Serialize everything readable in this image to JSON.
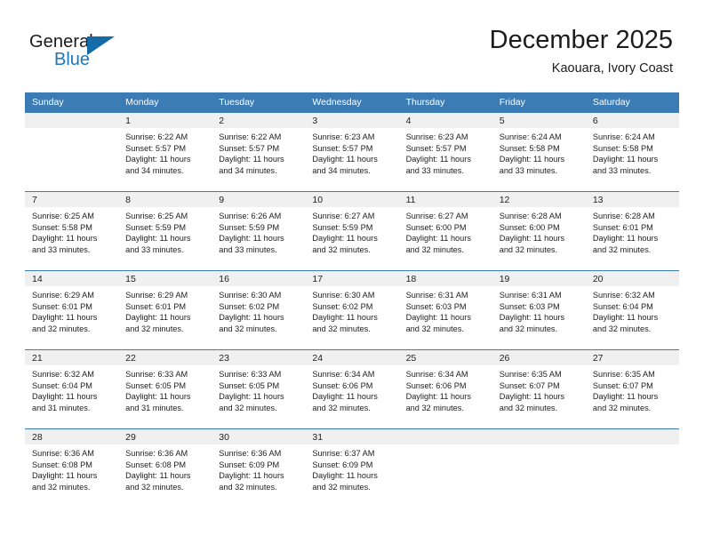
{
  "brand": {
    "name_part1": "General",
    "name_part2": "Blue",
    "flag_icon": "triangle-flag-icon",
    "accent_color": "#1878be"
  },
  "header": {
    "month_title": "December 2025",
    "location": "Kaouara, Ivory Coast"
  },
  "theme": {
    "header_row_bg": "#3b7cb5",
    "daynum_band_bg": "#f0f0f0",
    "cell_bg": "#ffffff",
    "text_color": "#1d1d1d"
  },
  "weekday_headers": [
    "Sunday",
    "Monday",
    "Tuesday",
    "Wednesday",
    "Thursday",
    "Friday",
    "Saturday"
  ],
  "weeks": [
    {
      "days": [
        {
          "number": "",
          "sunrise": "",
          "sunset": "",
          "daylight_line1": "",
          "daylight_line2": "",
          "empty": true
        },
        {
          "number": "1",
          "sunrise": "Sunrise: 6:22 AM",
          "sunset": "Sunset: 5:57 PM",
          "daylight_line1": "Daylight: 11 hours",
          "daylight_line2": "and 34 minutes.",
          "empty": false
        },
        {
          "number": "2",
          "sunrise": "Sunrise: 6:22 AM",
          "sunset": "Sunset: 5:57 PM",
          "daylight_line1": "Daylight: 11 hours",
          "daylight_line2": "and 34 minutes.",
          "empty": false
        },
        {
          "number": "3",
          "sunrise": "Sunrise: 6:23 AM",
          "sunset": "Sunset: 5:57 PM",
          "daylight_line1": "Daylight: 11 hours",
          "daylight_line2": "and 34 minutes.",
          "empty": false
        },
        {
          "number": "4",
          "sunrise": "Sunrise: 6:23 AM",
          "sunset": "Sunset: 5:57 PM",
          "daylight_line1": "Daylight: 11 hours",
          "daylight_line2": "and 33 minutes.",
          "empty": false
        },
        {
          "number": "5",
          "sunrise": "Sunrise: 6:24 AM",
          "sunset": "Sunset: 5:58 PM",
          "daylight_line1": "Daylight: 11 hours",
          "daylight_line2": "and 33 minutes.",
          "empty": false
        },
        {
          "number": "6",
          "sunrise": "Sunrise: 6:24 AM",
          "sunset": "Sunset: 5:58 PM",
          "daylight_line1": "Daylight: 11 hours",
          "daylight_line2": "and 33 minutes.",
          "empty": false
        }
      ]
    },
    {
      "days": [
        {
          "number": "7",
          "sunrise": "Sunrise: 6:25 AM",
          "sunset": "Sunset: 5:58 PM",
          "daylight_line1": "Daylight: 11 hours",
          "daylight_line2": "and 33 minutes.",
          "empty": false
        },
        {
          "number": "8",
          "sunrise": "Sunrise: 6:25 AM",
          "sunset": "Sunset: 5:59 PM",
          "daylight_line1": "Daylight: 11 hours",
          "daylight_line2": "and 33 minutes.",
          "empty": false
        },
        {
          "number": "9",
          "sunrise": "Sunrise: 6:26 AM",
          "sunset": "Sunset: 5:59 PM",
          "daylight_line1": "Daylight: 11 hours",
          "daylight_line2": "and 33 minutes.",
          "empty": false
        },
        {
          "number": "10",
          "sunrise": "Sunrise: 6:27 AM",
          "sunset": "Sunset: 5:59 PM",
          "daylight_line1": "Daylight: 11 hours",
          "daylight_line2": "and 32 minutes.",
          "empty": false
        },
        {
          "number": "11",
          "sunrise": "Sunrise: 6:27 AM",
          "sunset": "Sunset: 6:00 PM",
          "daylight_line1": "Daylight: 11 hours",
          "daylight_line2": "and 32 minutes.",
          "empty": false
        },
        {
          "number": "12",
          "sunrise": "Sunrise: 6:28 AM",
          "sunset": "Sunset: 6:00 PM",
          "daylight_line1": "Daylight: 11 hours",
          "daylight_line2": "and 32 minutes.",
          "empty": false
        },
        {
          "number": "13",
          "sunrise": "Sunrise: 6:28 AM",
          "sunset": "Sunset: 6:01 PM",
          "daylight_line1": "Daylight: 11 hours",
          "daylight_line2": "and 32 minutes.",
          "empty": false
        }
      ]
    },
    {
      "days": [
        {
          "number": "14",
          "sunrise": "Sunrise: 6:29 AM",
          "sunset": "Sunset: 6:01 PM",
          "daylight_line1": "Daylight: 11 hours",
          "daylight_line2": "and 32 minutes.",
          "empty": false
        },
        {
          "number": "15",
          "sunrise": "Sunrise: 6:29 AM",
          "sunset": "Sunset: 6:01 PM",
          "daylight_line1": "Daylight: 11 hours",
          "daylight_line2": "and 32 minutes.",
          "empty": false
        },
        {
          "number": "16",
          "sunrise": "Sunrise: 6:30 AM",
          "sunset": "Sunset: 6:02 PM",
          "daylight_line1": "Daylight: 11 hours",
          "daylight_line2": "and 32 minutes.",
          "empty": false
        },
        {
          "number": "17",
          "sunrise": "Sunrise: 6:30 AM",
          "sunset": "Sunset: 6:02 PM",
          "daylight_line1": "Daylight: 11 hours",
          "daylight_line2": "and 32 minutes.",
          "empty": false
        },
        {
          "number": "18",
          "sunrise": "Sunrise: 6:31 AM",
          "sunset": "Sunset: 6:03 PM",
          "daylight_line1": "Daylight: 11 hours",
          "daylight_line2": "and 32 minutes.",
          "empty": false
        },
        {
          "number": "19",
          "sunrise": "Sunrise: 6:31 AM",
          "sunset": "Sunset: 6:03 PM",
          "daylight_line1": "Daylight: 11 hours",
          "daylight_line2": "and 32 minutes.",
          "empty": false
        },
        {
          "number": "20",
          "sunrise": "Sunrise: 6:32 AM",
          "sunset": "Sunset: 6:04 PM",
          "daylight_line1": "Daylight: 11 hours",
          "daylight_line2": "and 32 minutes.",
          "empty": false
        }
      ]
    },
    {
      "days": [
        {
          "number": "21",
          "sunrise": "Sunrise: 6:32 AM",
          "sunset": "Sunset: 6:04 PM",
          "daylight_line1": "Daylight: 11 hours",
          "daylight_line2": "and 31 minutes.",
          "empty": false
        },
        {
          "number": "22",
          "sunrise": "Sunrise: 6:33 AM",
          "sunset": "Sunset: 6:05 PM",
          "daylight_line1": "Daylight: 11 hours",
          "daylight_line2": "and 31 minutes.",
          "empty": false
        },
        {
          "number": "23",
          "sunrise": "Sunrise: 6:33 AM",
          "sunset": "Sunset: 6:05 PM",
          "daylight_line1": "Daylight: 11 hours",
          "daylight_line2": "and 32 minutes.",
          "empty": false
        },
        {
          "number": "24",
          "sunrise": "Sunrise: 6:34 AM",
          "sunset": "Sunset: 6:06 PM",
          "daylight_line1": "Daylight: 11 hours",
          "daylight_line2": "and 32 minutes.",
          "empty": false
        },
        {
          "number": "25",
          "sunrise": "Sunrise: 6:34 AM",
          "sunset": "Sunset: 6:06 PM",
          "daylight_line1": "Daylight: 11 hours",
          "daylight_line2": "and 32 minutes.",
          "empty": false
        },
        {
          "number": "26",
          "sunrise": "Sunrise: 6:35 AM",
          "sunset": "Sunset: 6:07 PM",
          "daylight_line1": "Daylight: 11 hours",
          "daylight_line2": "and 32 minutes.",
          "empty": false
        },
        {
          "number": "27",
          "sunrise": "Sunrise: 6:35 AM",
          "sunset": "Sunset: 6:07 PM",
          "daylight_line1": "Daylight: 11 hours",
          "daylight_line2": "and 32 minutes.",
          "empty": false
        }
      ]
    },
    {
      "days": [
        {
          "number": "28",
          "sunrise": "Sunrise: 6:36 AM",
          "sunset": "Sunset: 6:08 PM",
          "daylight_line1": "Daylight: 11 hours",
          "daylight_line2": "and 32 minutes.",
          "empty": false
        },
        {
          "number": "29",
          "sunrise": "Sunrise: 6:36 AM",
          "sunset": "Sunset: 6:08 PM",
          "daylight_line1": "Daylight: 11 hours",
          "daylight_line2": "and 32 minutes.",
          "empty": false
        },
        {
          "number": "30",
          "sunrise": "Sunrise: 6:36 AM",
          "sunset": "Sunset: 6:09 PM",
          "daylight_line1": "Daylight: 11 hours",
          "daylight_line2": "and 32 minutes.",
          "empty": false
        },
        {
          "number": "31",
          "sunrise": "Sunrise: 6:37 AM",
          "sunset": "Sunset: 6:09 PM",
          "daylight_line1": "Daylight: 11 hours",
          "daylight_line2": "and 32 minutes.",
          "empty": false
        },
        {
          "number": "",
          "sunrise": "",
          "sunset": "",
          "daylight_line1": "",
          "daylight_line2": "",
          "empty": true
        },
        {
          "number": "",
          "sunrise": "",
          "sunset": "",
          "daylight_line1": "",
          "daylight_line2": "",
          "empty": true
        },
        {
          "number": "",
          "sunrise": "",
          "sunset": "",
          "daylight_line1": "",
          "daylight_line2": "",
          "empty": true
        }
      ]
    }
  ]
}
